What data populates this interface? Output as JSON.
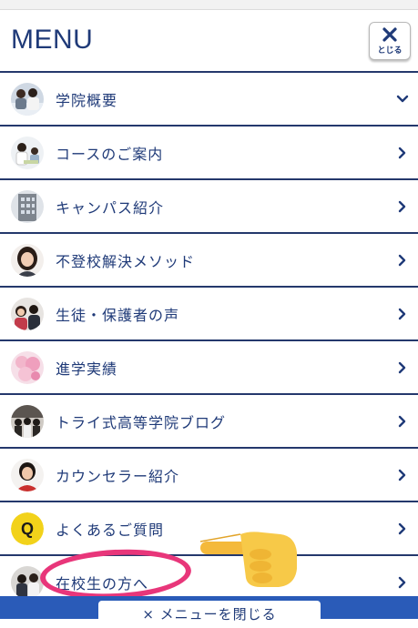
{
  "header": {
    "title": "MENU",
    "close_label": "とじる"
  },
  "menu_items": [
    {
      "label": "学院概要",
      "icon": "chevron-down-icon"
    },
    {
      "label": "コースのご案内",
      "icon": "chevron-right-icon"
    },
    {
      "label": "キャンパス紹介",
      "icon": "chevron-right-icon"
    },
    {
      "label": "不登校解決メソッド",
      "icon": "chevron-right-icon"
    },
    {
      "label": "生徒・保護者の声",
      "icon": "chevron-right-icon"
    },
    {
      "label": "進学実績",
      "icon": "chevron-right-icon"
    },
    {
      "label": "トライ式高等学院ブログ",
      "icon": "chevron-right-icon"
    },
    {
      "label": "カウンセラー紹介",
      "icon": "chevron-right-icon"
    },
    {
      "label": "よくあるご質問",
      "icon": "chevron-right-icon",
      "badge": "Q"
    },
    {
      "label": "在校生の方へ",
      "icon": "chevron-right-icon"
    }
  ],
  "footer": {
    "close_menu_label": "× メニューを閉じる"
  },
  "colors": {
    "brand_navy": "#1f3a78",
    "footer_blue": "#2a5bb8",
    "highlight_pink": "#e8367a",
    "faq_yellow": "#f2d21a"
  }
}
